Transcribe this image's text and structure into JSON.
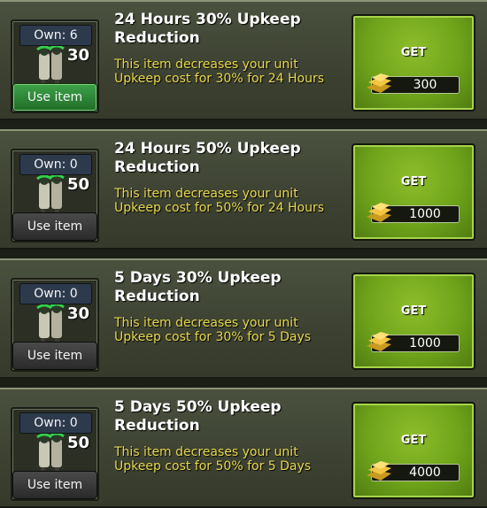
{
  "items": [
    {
      "own": "Own: 6",
      "percent": "30",
      "title": "24 Hours 30% Upkeep Reduction",
      "description": "This item decreases your unit Upkeep cost for 30% for 24 Hours",
      "use_label": "Use item",
      "use_active": true,
      "get_label": "GET",
      "price": "300",
      "price_icon": "gold-bars-icon"
    },
    {
      "own": "Own: 0",
      "percent": "50",
      "title": "24 Hours 50% Upkeep Reduction",
      "description": "This item decreases your unit Upkeep cost for 50% for 24 Hours",
      "use_label": "Use item",
      "use_active": false,
      "get_label": "GET",
      "price": "1000",
      "price_icon": "gold-bars-icon"
    },
    {
      "own": "Own: 0",
      "percent": "30",
      "title": "5 Days 30% Upkeep Reduction",
      "description": "This item decreases your unit Upkeep cost for 30% for 5 Days",
      "use_label": "Use item",
      "use_active": false,
      "get_label": "GET",
      "price": "1000",
      "price_icon": "gold-bars-icon"
    },
    {
      "own": "Own: 0",
      "percent": "50",
      "title": "5 Days 50% Upkeep Reduction",
      "description": "This item decreases your unit Upkeep cost for 50% for 5 Days",
      "use_label": "Use item",
      "use_active": false,
      "get_label": "GET",
      "price": "4000",
      "price_icon": "gold-bars-icon"
    }
  ],
  "colors": {
    "title": "#ffffff",
    "description": "#e6d74d",
    "get_button": "#6ea31a",
    "use_active": "#2f8a3a"
  }
}
